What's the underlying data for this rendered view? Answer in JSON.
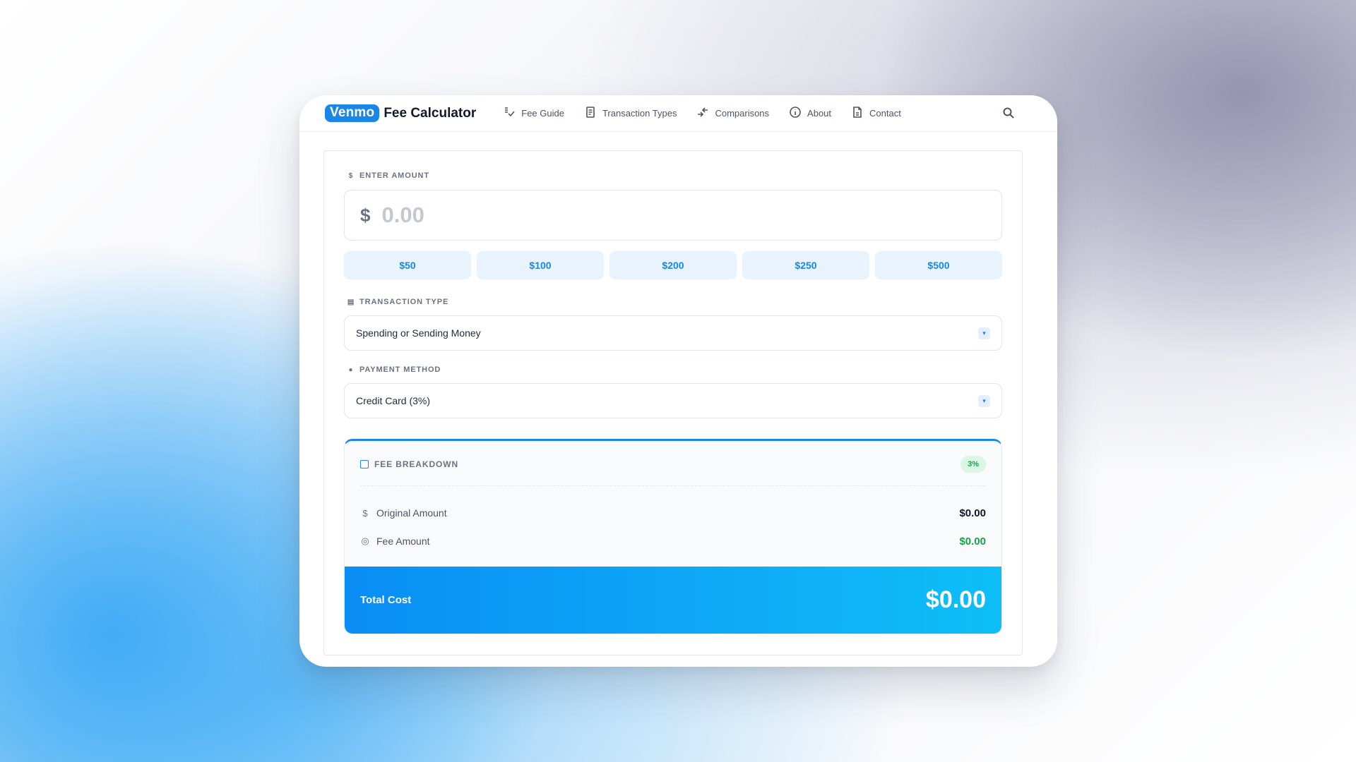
{
  "brand": {
    "pill": "Venmo",
    "text": "Fee Calculator"
  },
  "nav": [
    {
      "label": "Fee Guide",
      "icon": "fee-guide-icon"
    },
    {
      "label": "Transaction Types",
      "icon": "receipt-icon"
    },
    {
      "label": "Comparisons",
      "icon": "compare-arrows-icon"
    },
    {
      "label": "About",
      "icon": "info-icon"
    },
    {
      "label": "Contact",
      "icon": "document-icon"
    }
  ],
  "amount": {
    "label": "ENTER AMOUNT",
    "currency_symbol": "$",
    "placeholder": "0.00"
  },
  "quick_amounts": [
    "$50",
    "$100",
    "$200",
    "$250",
    "$500"
  ],
  "transaction_type": {
    "label": "TRANSACTION TYPE",
    "selected": "Spending or Sending Money"
  },
  "payment_method": {
    "label": "PAYMENT METHOD",
    "selected": "Credit Card (3%)"
  },
  "breakdown": {
    "title": "FEE BREAKDOWN",
    "badge": "3%",
    "original_label": "Original Amount",
    "original_value": "$0.00",
    "fee_label": "Fee Amount",
    "fee_value": "$0.00",
    "total_label": "Total Cost",
    "total_value": "$0.00"
  },
  "colors": {
    "accent": "#1a86e8",
    "fee_green": "#16a34a",
    "total_gradient_start": "#0a8df5",
    "total_gradient_end": "#0dbef7"
  }
}
